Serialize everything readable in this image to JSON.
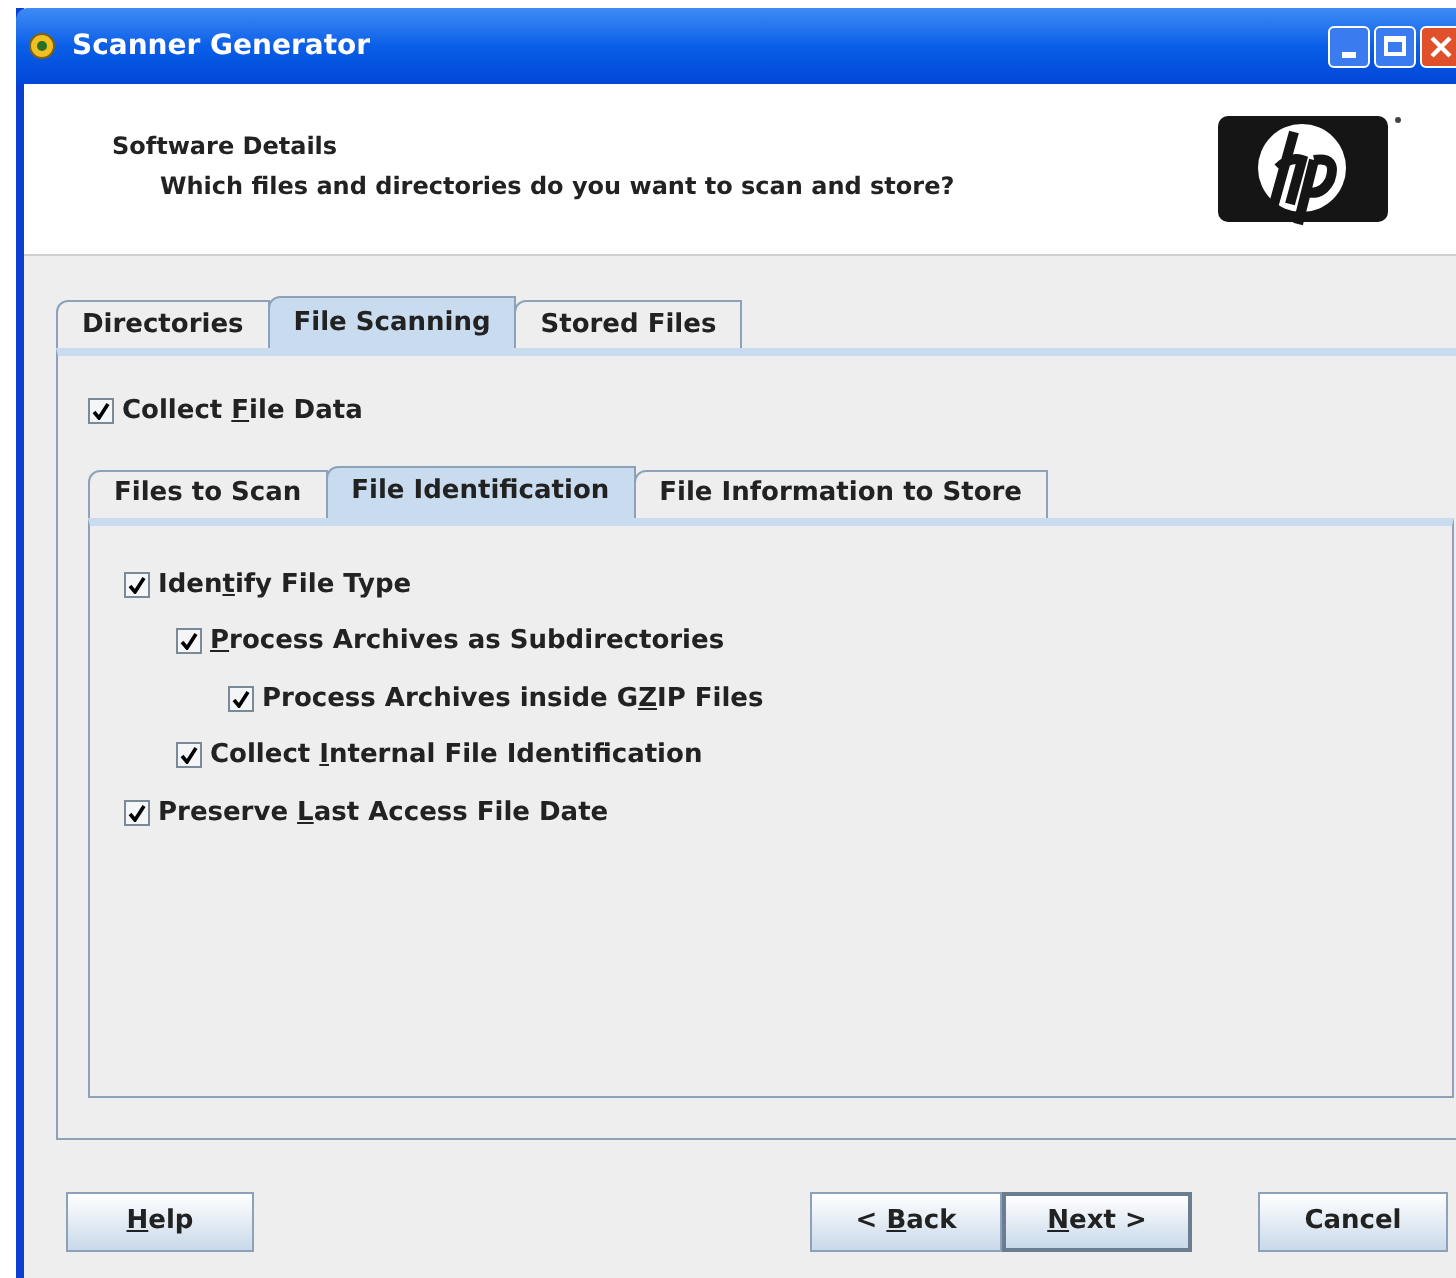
{
  "window": {
    "title": "Scanner Generator"
  },
  "header": {
    "title": "Software Details",
    "subtitle": "Which files and directories do you want to scan and store?"
  },
  "tabs": [
    {
      "label": "Directories",
      "selected": false
    },
    {
      "label": "File Scanning",
      "selected": true
    },
    {
      "label": "Stored Files",
      "selected": false
    }
  ],
  "collect": {
    "label": {
      "before": "Collect ",
      "key": "F",
      "after": "ile Data"
    },
    "checked": true
  },
  "subtabs": [
    {
      "label": "Files to Scan",
      "selected": false
    },
    {
      "label": "File Identification",
      "selected": true
    },
    {
      "label": "File Information to Store",
      "selected": false
    }
  ],
  "options": [
    {
      "label": {
        "before": "Iden",
        "key": "t",
        "after": "ify File Type"
      },
      "checked": true,
      "children": [
        {
          "label": {
            "key": "P",
            "after": "rocess Archives as Subdirectories"
          },
          "checked": true,
          "children": [
            {
              "label": {
                "before": "Process Archives inside G",
                "key": "Z",
                "after": "IP Files"
              },
              "checked": true
            }
          ]
        },
        {
          "label": {
            "before": "Collect ",
            "key": "I",
            "after": "nternal File Identification"
          },
          "checked": true
        }
      ]
    },
    {
      "label": {
        "before": "Preserve ",
        "key": "L",
        "after": "ast Access File Date"
      },
      "checked": true
    }
  ],
  "buttons": {
    "help": {
      "key": "H",
      "after": "elp"
    },
    "back": {
      "before": "< ",
      "key": "B",
      "after": "ack"
    },
    "next": {
      "key": "N",
      "after": "ext >"
    },
    "cancel": {
      "after": "Cancel"
    }
  }
}
